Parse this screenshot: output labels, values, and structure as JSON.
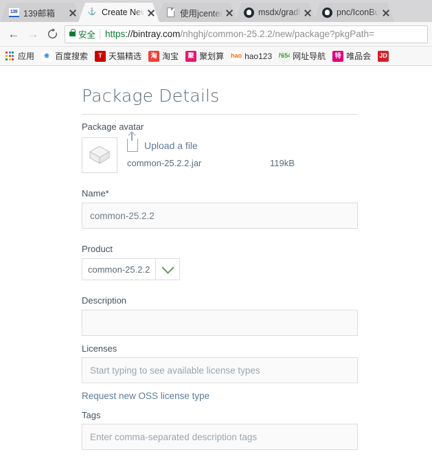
{
  "browser": {
    "tabs": [
      {
        "title": "139邮箱",
        "favicon": "mail139-icon",
        "active": false
      },
      {
        "title": "Create New",
        "favicon": "anchor-icon",
        "active": true
      },
      {
        "title": "使用jcenter",
        "favicon": "document-icon",
        "active": false
      },
      {
        "title": "msdx/gradl",
        "favicon": "github-icon",
        "active": false
      },
      {
        "title": "pnc/IconBu",
        "favicon": "github-icon",
        "active": false
      }
    ],
    "close_label": "×",
    "nav": {
      "back": "←",
      "forward": "→",
      "reload": "C"
    },
    "omnibox": {
      "secure_label": "安全",
      "url_scheme": "https",
      "url_host": "://bintray.com",
      "url_path": "/nhghj/common-25.2.2/new/package?pkgPath=",
      "full_url": "https://bintray.com/nhghj/common-25.2.2/new/package?pkgPath="
    },
    "bookmarks": [
      {
        "label": "应用",
        "icon": "apps-grid-icon",
        "icon_text": ""
      },
      {
        "label": "百度搜索",
        "icon": "baidu-icon",
        "icon_text": "❀"
      },
      {
        "label": "天猫精选",
        "icon": "tmall-icon",
        "icon_text": "T"
      },
      {
        "label": "淘宝",
        "icon": "taobao-icon",
        "icon_text": "淘"
      },
      {
        "label": "聚划算",
        "icon": "juhuasuan-icon",
        "icon_text": "聚"
      },
      {
        "label": "hao123",
        "icon": "hao123-icon",
        "icon_text": "hao"
      },
      {
        "label": "网址导航",
        "icon": "nav7654-icon",
        "icon_text": "7654"
      },
      {
        "label": "唯品会",
        "icon": "vip-icon",
        "icon_text": "特"
      },
      {
        "label": "",
        "icon": "jd-icon",
        "icon_text": "JD"
      }
    ]
  },
  "page": {
    "title": "Package Details",
    "avatar": {
      "label": "Package avatar",
      "placeholder_icon": "package-cube-icon",
      "upload_link": "Upload a file",
      "upload_icon": "upload-arrow-icon",
      "file_name": "common-25.2.2.jar",
      "file_size": "119kB"
    },
    "fields": {
      "name": {
        "label": "Name*",
        "value": "common-25.2.2",
        "placeholder": ""
      },
      "product": {
        "label": "Product",
        "value": "common-25.2.2",
        "arrow_icon": "chevron-down-icon"
      },
      "description": {
        "label": "Description",
        "value": "",
        "placeholder": ""
      },
      "licenses": {
        "label": "Licenses",
        "value": "",
        "placeholder": "Start typing to see available license types"
      },
      "oss_link": "Request new OSS license type",
      "tags": {
        "label": "Tags",
        "value": "",
        "placeholder": "Enter comma-separated description tags"
      }
    }
  },
  "colors": {
    "accent_green": "#5fa24a",
    "secure_green": "#0a7b34",
    "link_blue": "#5e7b96",
    "heading": "#5b6975"
  }
}
